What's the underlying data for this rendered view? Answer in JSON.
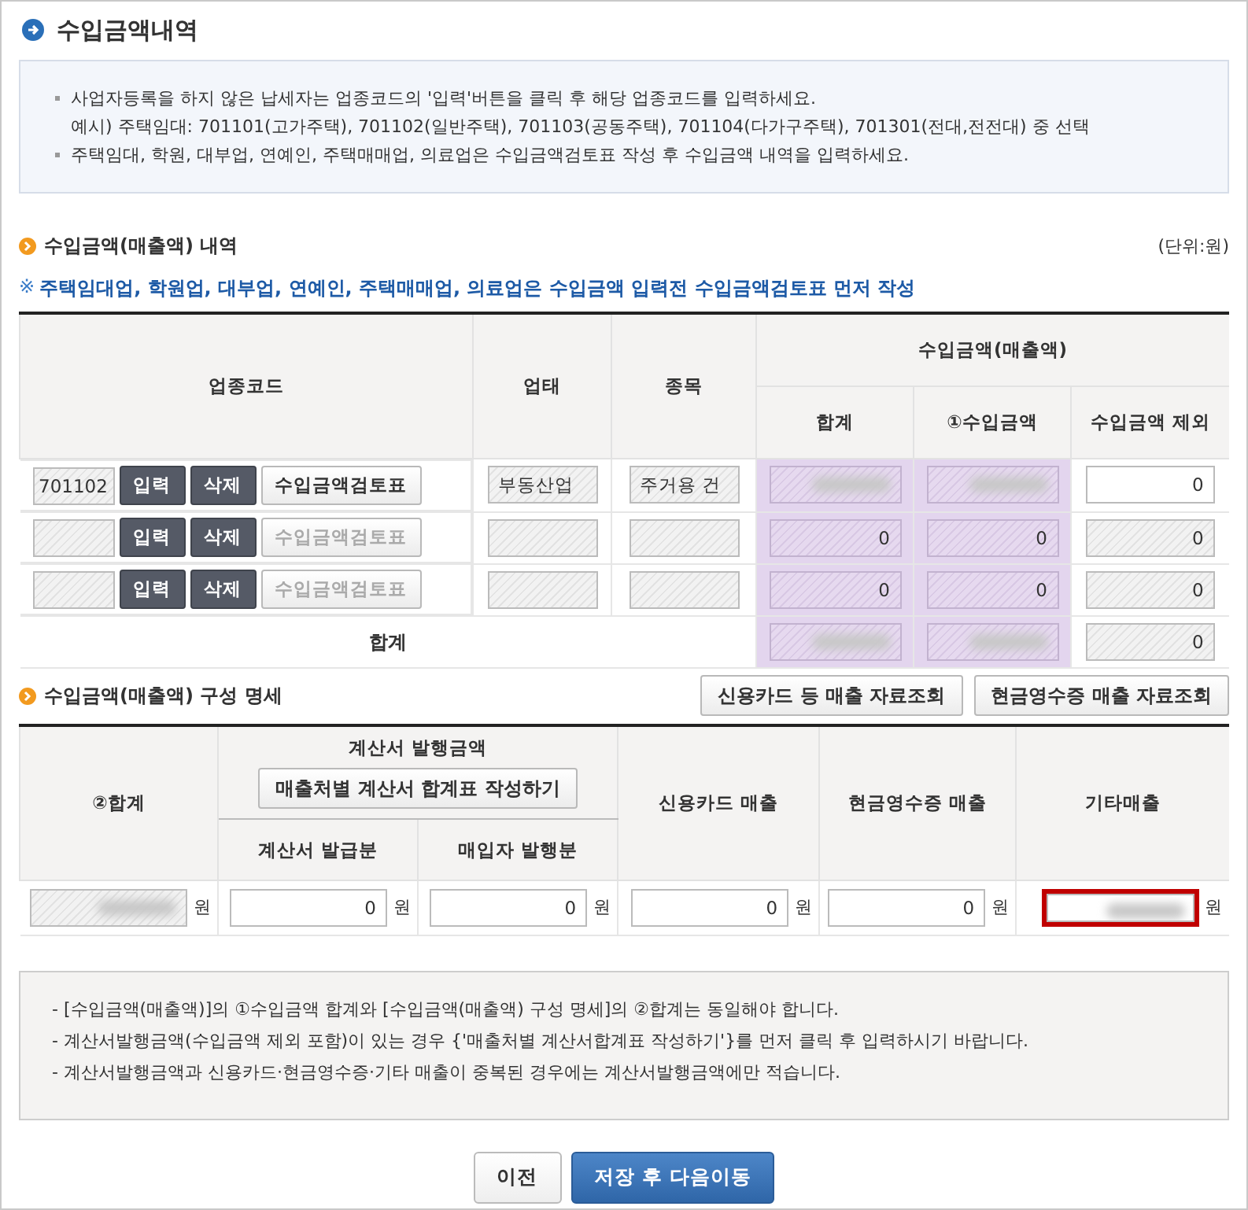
{
  "title": "수입금액내역",
  "notice": [
    {
      "lines": [
        "사업자등록을 하지 않은 납세자는 업종코드의 '입력'버튼을 클릭 후 해당 업종코드를 입력하세요.",
        "예시) 주택임대: 701101(고가주택), 701102(일반주택), 701103(공동주택), 701104(다가구주택), 701301(전대,전전대) 중 선택"
      ]
    },
    {
      "lines": [
        "주택임대, 학원, 대부업, 연예인, 주택매매업, 의료업은 수입금액검토표 작성 후 수입금액 내역을 입력하세요."
      ]
    }
  ],
  "section1": {
    "title": "수입금액(매출액) 내역",
    "unit": "(단위:원)",
    "warning_mark": "※",
    "warning": "주택임대업, 학원업, 대부업, 연예인, 주택매매업, 의료업은 수입금액 입력전 수입금액검토표 먼저 작성"
  },
  "table1": {
    "headers": {
      "code": "업종코드",
      "type": "업태",
      "item": "종목",
      "group": "수입금액(매출액)",
      "total": "합계",
      "income": "①수입금액",
      "excluded": "수입금액 제외"
    },
    "rows": [
      {
        "code": {
          "value": "701102",
          "disabled": true
        },
        "buttons": [
          {
            "label": "입력",
            "kind": "dark"
          },
          {
            "label": "삭제",
            "kind": "dark"
          },
          {
            "label": "수입금액검토표",
            "kind": "light",
            "disabled": false
          }
        ],
        "type": {
          "value": "부동산업",
          "disabled": true
        },
        "item": {
          "value": "주거용 건",
          "disabled": true
        },
        "total": {
          "disabled": true,
          "redacted": true
        },
        "income": {
          "disabled": true,
          "redacted": true
        },
        "excluded": {
          "value": "0",
          "disabled": false
        }
      },
      {
        "code": {
          "disabled": true
        },
        "buttons": [
          {
            "label": "입력",
            "kind": "dark"
          },
          {
            "label": "삭제",
            "kind": "dark"
          },
          {
            "label": "수입금액검토표",
            "kind": "light",
            "disabled": true
          }
        ],
        "type": {
          "disabled": true
        },
        "item": {
          "disabled": true
        },
        "total": {
          "value": "0",
          "disabled": true
        },
        "income": {
          "value": "0",
          "disabled": true
        },
        "excluded": {
          "value": "0",
          "disabled": true
        }
      },
      {
        "code": {
          "disabled": true
        },
        "buttons": [
          {
            "label": "입력",
            "kind": "dark"
          },
          {
            "label": "삭제",
            "kind": "dark"
          },
          {
            "label": "수입금액검토표",
            "kind": "light",
            "disabled": true
          }
        ],
        "type": {
          "disabled": true
        },
        "item": {
          "disabled": true
        },
        "total": {
          "value": "0",
          "disabled": true
        },
        "income": {
          "value": "0",
          "disabled": true
        },
        "excluded": {
          "value": "0",
          "disabled": true
        }
      }
    ],
    "total_row": {
      "label": "합계",
      "total": {
        "disabled": true,
        "redacted": true
      },
      "income": {
        "disabled": true,
        "redacted": true
      },
      "excluded": {
        "value": "0",
        "disabled": true
      }
    }
  },
  "section2": {
    "title": "수입금액(매출액) 구성 명세",
    "buttons": [
      "신용카드 등 매출 자료조회",
      "현금영수증 매출 자료조회"
    ]
  },
  "table2": {
    "headers": {
      "sum": "②합계",
      "invoice": "계산서 발행금액",
      "invoice_button": "매출처별 계산서 합계표 작성하기",
      "issued": "계산서 발급분",
      "buyer": "매입자 발행분",
      "card": "신용카드 매출",
      "cash": "현금영수증 매출",
      "other": "기타매출"
    },
    "cells": [
      {
        "field": {
          "disabled": true,
          "redacted": true
        },
        "unit": "원"
      },
      {
        "field": {
          "value": "0",
          "disabled": false
        },
        "unit": "원"
      },
      {
        "field": {
          "value": "0",
          "disabled": false
        },
        "unit": "원"
      },
      {
        "field": {
          "value": "0",
          "disabled": false
        },
        "unit": "원"
      },
      {
        "field": {
          "value": "0",
          "disabled": false
        },
        "unit": "원"
      },
      {
        "field": {
          "disabled": false,
          "redacted": true,
          "highlighted": true
        },
        "unit": "원"
      }
    ]
  },
  "notes": [
    "- [수입금액(매출액)]의 ①수입금액 합계와 [수입금액(매출액) 구성 명세]의 ②합계는 동일해야 합니다.",
    "- 계산서발행금액(수입금액 제외 포함)이 있는 경우 {'매출처별 계산서합계표 작성하기'}를 먼저 클릭 후 입력하시기 바랍니다.",
    "- 계산서발행금액과 신용카드·현금영수증·기타 매출이 중복된 경우에는 계산서발행금액에만 적습니다."
  ],
  "footer_buttons": [
    {
      "label": "이전",
      "kind": "secondary"
    },
    {
      "label": "저장 후 다음이동",
      "kind": "primary"
    }
  ]
}
